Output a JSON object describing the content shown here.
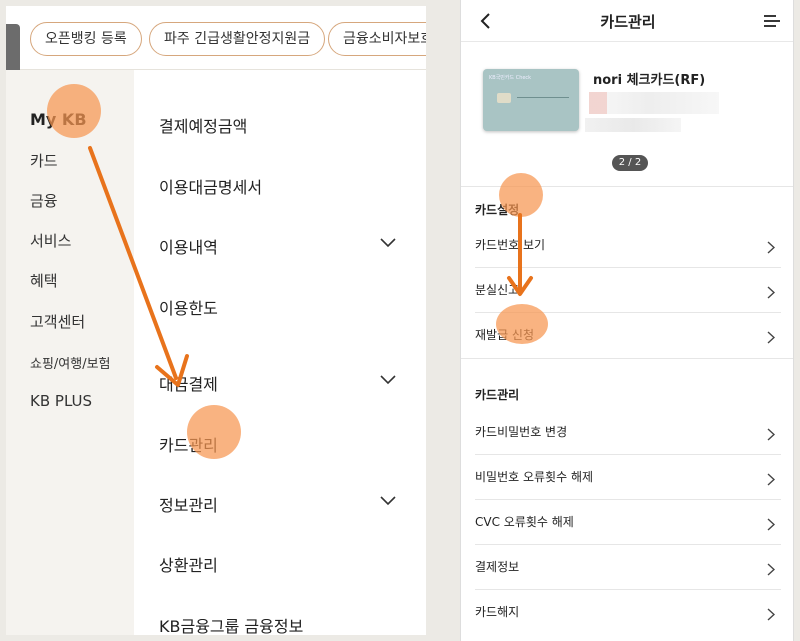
{
  "left": {
    "chips": [
      "오픈뱅킹 등록",
      "파주 긴급생활안정지원금",
      "금융소비자보호"
    ],
    "sidebar": [
      "My KB",
      "카드",
      "금융",
      "서비스",
      "혜택",
      "고객센터",
      "쇼핑/여행/보험",
      "KB PLUS"
    ],
    "menu": {
      "payment_due": "결제예정금액",
      "statement": "이용대금명세서",
      "history": "이용내역",
      "limit": "이용한도",
      "instead_pay": "대금결제",
      "card_manage": "카드관리",
      "info_manage": "정보관리",
      "repay_manage": "상환관리",
      "kb_group": "KB금융그룹 금융정보"
    }
  },
  "right": {
    "title": "카드관리",
    "card": {
      "name": "nori 체크카드(RF)",
      "brand": "KB국민카드 Check",
      "page_indicator": "2 / 2"
    },
    "sections": {
      "settings_title": "카드설정",
      "settings_items": [
        "카드번호 보기",
        "분실신고",
        "재발급 신청"
      ],
      "manage_title": "카드관리",
      "manage_items": [
        "카드비밀번호 변경",
        "비밀번호 오류횟수 해제",
        "CVC 오류횟수 해제",
        "결제정보",
        "카드해지"
      ]
    }
  },
  "colors": {
    "accent_orange": "#e8731c",
    "dot_orange": "#f79650",
    "chip_border": "#d6a77d",
    "sidebar_bg": "#f5f3ef",
    "card_teal": "#a9c4c4"
  },
  "icons": [
    "back-arrow-icon",
    "hamburger-menu-icon",
    "chevron-down-icon",
    "chevron-right-icon",
    "card-chip-icon"
  ]
}
